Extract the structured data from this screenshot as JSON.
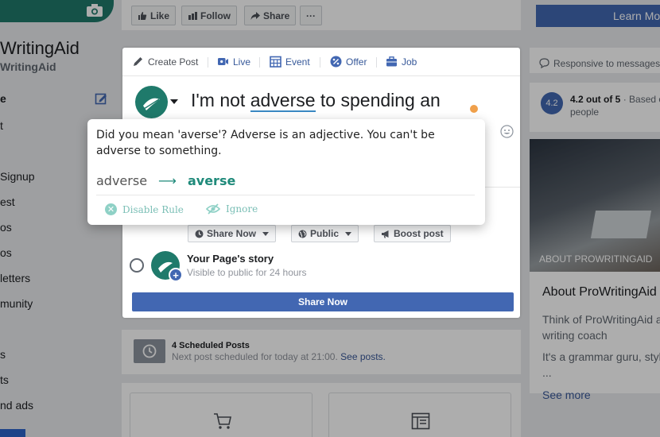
{
  "sidebar": {
    "page_name": "WritingAid",
    "page_handle": "WritingAid",
    "items": [
      {
        "label": "e",
        "active": true
      },
      {
        "label": "t"
      },
      {
        "label": " Signup"
      },
      {
        "label": "est"
      },
      {
        "label": "os"
      },
      {
        "label": "os"
      },
      {
        "label": "letters"
      },
      {
        "label": "munity"
      },
      {
        "label": "s"
      },
      {
        "label": "ts"
      },
      {
        "label": "nd ads"
      }
    ]
  },
  "action_bar": {
    "like": "Like",
    "follow": "Follow",
    "share": "Share",
    "more": "···",
    "learn_more": "Learn Mo"
  },
  "composer": {
    "tabs": [
      {
        "label": "Create Post",
        "icon": "pencil-icon"
      },
      {
        "label": "Live",
        "icon": "video-icon"
      },
      {
        "label": "Event",
        "icon": "calendar-icon"
      },
      {
        "label": "Offer",
        "icon": "percent-icon"
      },
      {
        "label": "Job",
        "icon": "briefcase-icon"
      }
    ],
    "text_before": "I'm not ",
    "text_error": "adverse",
    "text_after": " to spending an",
    "share_now_label": "Share Now",
    "public_label": "Public",
    "boost_label": "Boost post",
    "story_title": "Your Page's story",
    "story_sub": "Visible to public for 24 hours",
    "share_button": "Share Now"
  },
  "tooltip": {
    "message": "Did you mean 'averse'? Adverse is an adjective. You can't be adverse to something.",
    "original": "adverse",
    "arrow": "⟶",
    "suggestion": "averse",
    "disable_rule": "Disable Rule",
    "ignore": "Ignore",
    "accent_color": "#1f8a7a"
  },
  "scheduled": {
    "title": "4 Scheduled Posts",
    "subtitle": "Next post scheduled for today at 21:00.",
    "link": "See posts."
  },
  "right": {
    "responsive": "Responsive to messages",
    "rating_badge": "4.2",
    "rating_text": "4.2 out of 5",
    "rating_suffix": "· Based o",
    "rating_line2": "people",
    "about_caption": "ABOUT PROWRITINGAID",
    "about_title": "About ProWritingAid",
    "about_p1_l1": "Think of ProWritingAid a",
    "about_p1_l2": "writing coach",
    "about_p2_l1": "It's a grammar guru, styl",
    "about_p2_l2": "...",
    "see_more": "See more"
  }
}
